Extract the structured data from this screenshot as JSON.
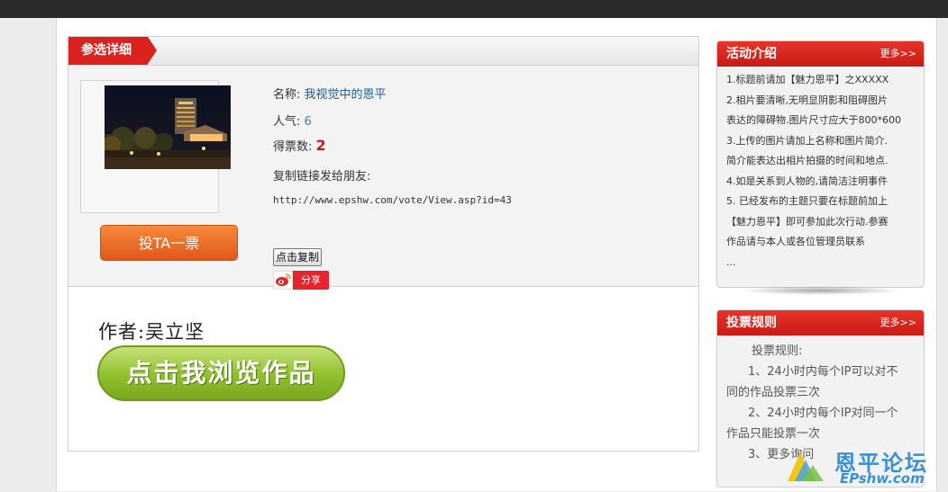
{
  "main": {
    "section_title": "参选详细",
    "vote_button": "投TA一票",
    "info": {
      "name_label": "名称:",
      "name_value": "我视觉中的恩平",
      "popularity_label": "人气:",
      "popularity_value": "6",
      "votes_label": "得票数:",
      "votes_value": "2",
      "share_label": "复制链接发给朋友:",
      "url": "http://www.epshw.com/vote/View.asp?id=43",
      "copy_button": "点击复制",
      "share_button": "分享"
    },
    "author": "作者:吴立坚",
    "browse_button": "点击我浏览作品"
  },
  "sidebar": {
    "activity": {
      "title": "活动介绍",
      "more": "更多>>",
      "lines": [
        "1.标题前请加【魅力恩平】之XXXXX",
        "2.相片要清晰,无明显阴影和阻碍图片",
        "表达的障碍物.图片尺寸应大于800*600",
        "3.上传的图片请加上名称和图片简介.",
        "简介能表达出相片拍摄的时间和地点.",
        "4.如是关系到人物的,请简洁注明事件",
        "5. 已经发布的主题只要在标题前加上",
        "【魅力恩平】即可参加此次行动.参赛",
        "作品请与本人或各位管理员联系",
        "..."
      ]
    },
    "rules": {
      "title": "投票规则",
      "more": "更多>>",
      "lines": [
        "投票规则:",
        "1、24小时内每个IP可以对不",
        "同的作品投票三次",
        "2、24小时内每个IP对同一个",
        "作品只能投票一次",
        "3、更多询问"
      ]
    }
  },
  "watermark": {
    "cn": "恩平论坛",
    "en": "EPshw.com"
  }
}
